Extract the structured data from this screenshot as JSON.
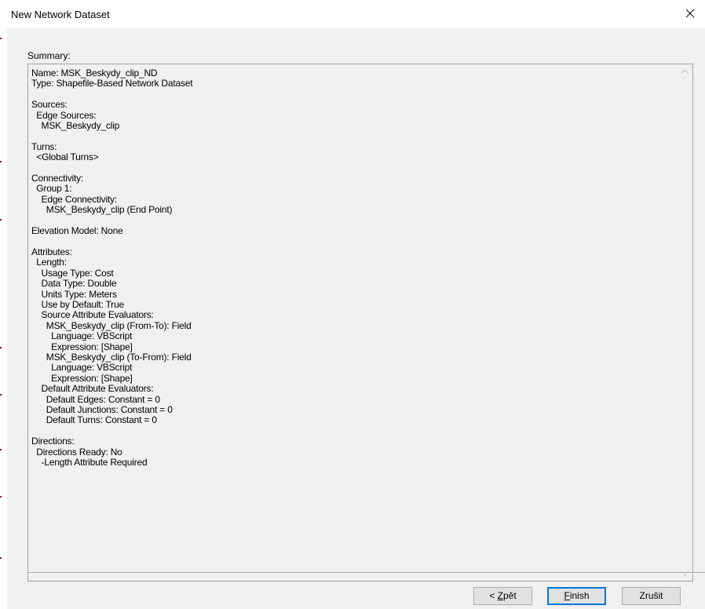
{
  "window": {
    "title": "New Network Dataset"
  },
  "summary": {
    "label": "Summary:",
    "text": "Name: MSK_Beskydy_clip_ND\nType: Shapefile-Based Network Dataset\n\nSources:\n  Edge Sources:\n    MSK_Beskydy_clip\n\nTurns:\n  <Global Turns>\n\nConnectivity:\n  Group 1:\n    Edge Connectivity:\n      MSK_Beskydy_clip (End Point)\n\nElevation Model: None\n\nAttributes:\n  Length:\n    Usage Type: Cost\n    Data Type: Double\n    Units Type: Meters\n    Use by Default: True\n    Source Attribute Evaluators:\n      MSK_Beskydy_clip (From-To): Field\n        Language: VBScript\n        Expression: [Shape]\n      MSK_Beskydy_clip (To-From): Field\n        Language: VBScript\n        Expression: [Shape]\n    Default Attribute Evaluators:\n      Default Edges: Constant = 0\n      Default Junctions: Constant = 0\n      Default Turns: Constant = 0\n\nDirections:\n  Directions Ready: No\n    -Length Attribute Required"
  },
  "buttons": {
    "back_prefix": "< ",
    "back_mnemonic": "Z",
    "back_rest": "pět",
    "finish_mnemonic": "F",
    "finish_rest": "inish",
    "cancel": "Zrušit"
  },
  "icons": {
    "close": "close-icon",
    "scroll_up": "chevron-up-icon",
    "scroll_down": "chevron-down-icon"
  },
  "colors": {
    "client_background": "#f0f0f0",
    "default_button_border": "#0078d7",
    "button_face": "#e1e1e1"
  }
}
